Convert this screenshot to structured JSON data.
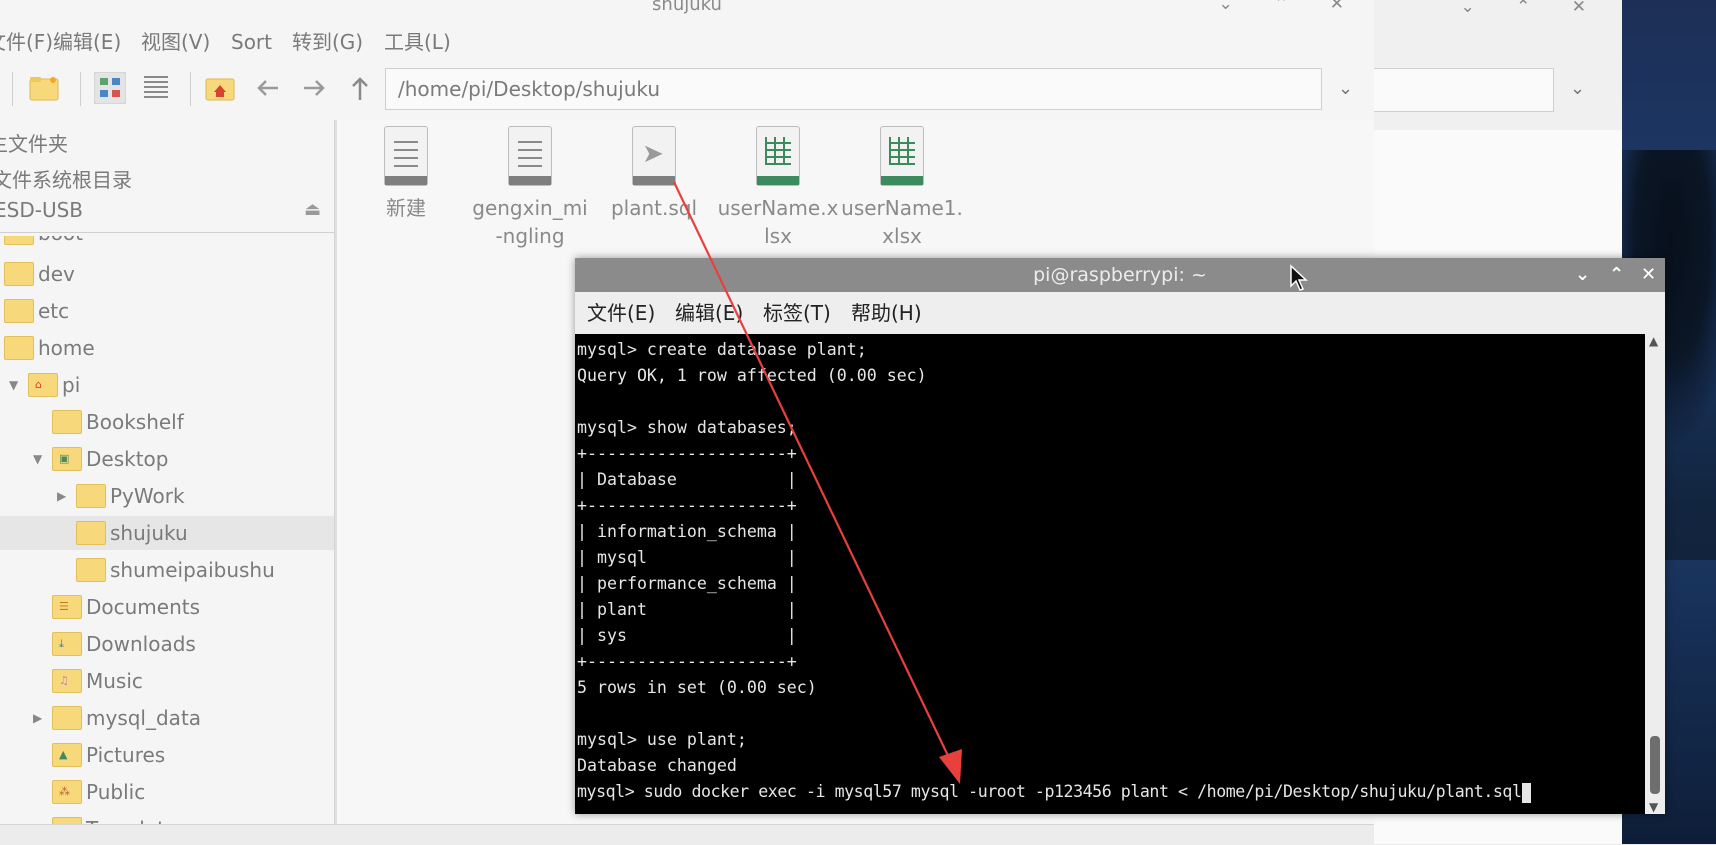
{
  "fm": {
    "window_title": "shujuku",
    "title_buttons": "⌄ ⌃ ✕",
    "menu": [
      "文件(F)",
      "编辑(E)",
      "视图(V)",
      "Sort",
      "转到(G)",
      "工具(L)"
    ],
    "menu_visible_first": "(F)",
    "address": "/home/pi/Desktop/shujuku",
    "places": [
      "主文件夹",
      "文件系统根目录",
      "ESD-USB"
    ],
    "places_visible": [
      "主文件夹",
      "文件系统根目录",
      "ESD-USB"
    ],
    "tree": {
      "boot": "boot",
      "dev": "dev",
      "etc": "etc",
      "home": "home",
      "pi": "pi",
      "bookshelf": "Bookshelf",
      "desktop": "Desktop",
      "pywork": "PyWork",
      "shujuku": "shujuku",
      "shumeipaibushu": "shumeipaibushu",
      "documents": "Documents",
      "downloads": "Downloads",
      "music": "Music",
      "mysql_data": "mysql_data",
      "pictures": "Pictures",
      "public": "Public",
      "templates": "Templates"
    },
    "files": [
      {
        "name": "新建",
        "icon": "text-file-icon"
      },
      {
        "name": "gengxin_mi-ngling",
        "icon": "text-file-icon"
      },
      {
        "name": "plant.sql",
        "icon": "sql-file-icon"
      },
      {
        "name": "userName.xlsx",
        "icon": "spreadsheet-icon"
      },
      {
        "name": "userName1.xlsx",
        "icon": "spreadsheet-icon"
      }
    ]
  },
  "term": {
    "title": "pi@raspberrypi: ~",
    "menu": [
      "文件(E)",
      "编辑(E)",
      "标签(T)",
      "帮助(H)"
    ],
    "lines": [
      "mysql> create database plant;",
      "Query OK, 1 row affected (0.00 sec)",
      "",
      "mysql> show databases;",
      "+--------------------+",
      "| Database           |",
      "+--------------------+",
      "| information_schema |",
      "| mysql              |",
      "| performance_schema |",
      "| plant              |",
      "| sys                |",
      "+--------------------+",
      "5 rows in set (0.00 sec)",
      "",
      "mysql> use plant;",
      "Database changed",
      "mysql> sudo docker exec -i mysql57 mysql -uroot -p123456 plant < /home/pi/Desktop/shujuku/plant.sql"
    ]
  },
  "colors": {
    "annotation_arrow": "#e8403c",
    "terminal_bg": "#000000",
    "terminal_titlebar": "#8b8b8b"
  }
}
